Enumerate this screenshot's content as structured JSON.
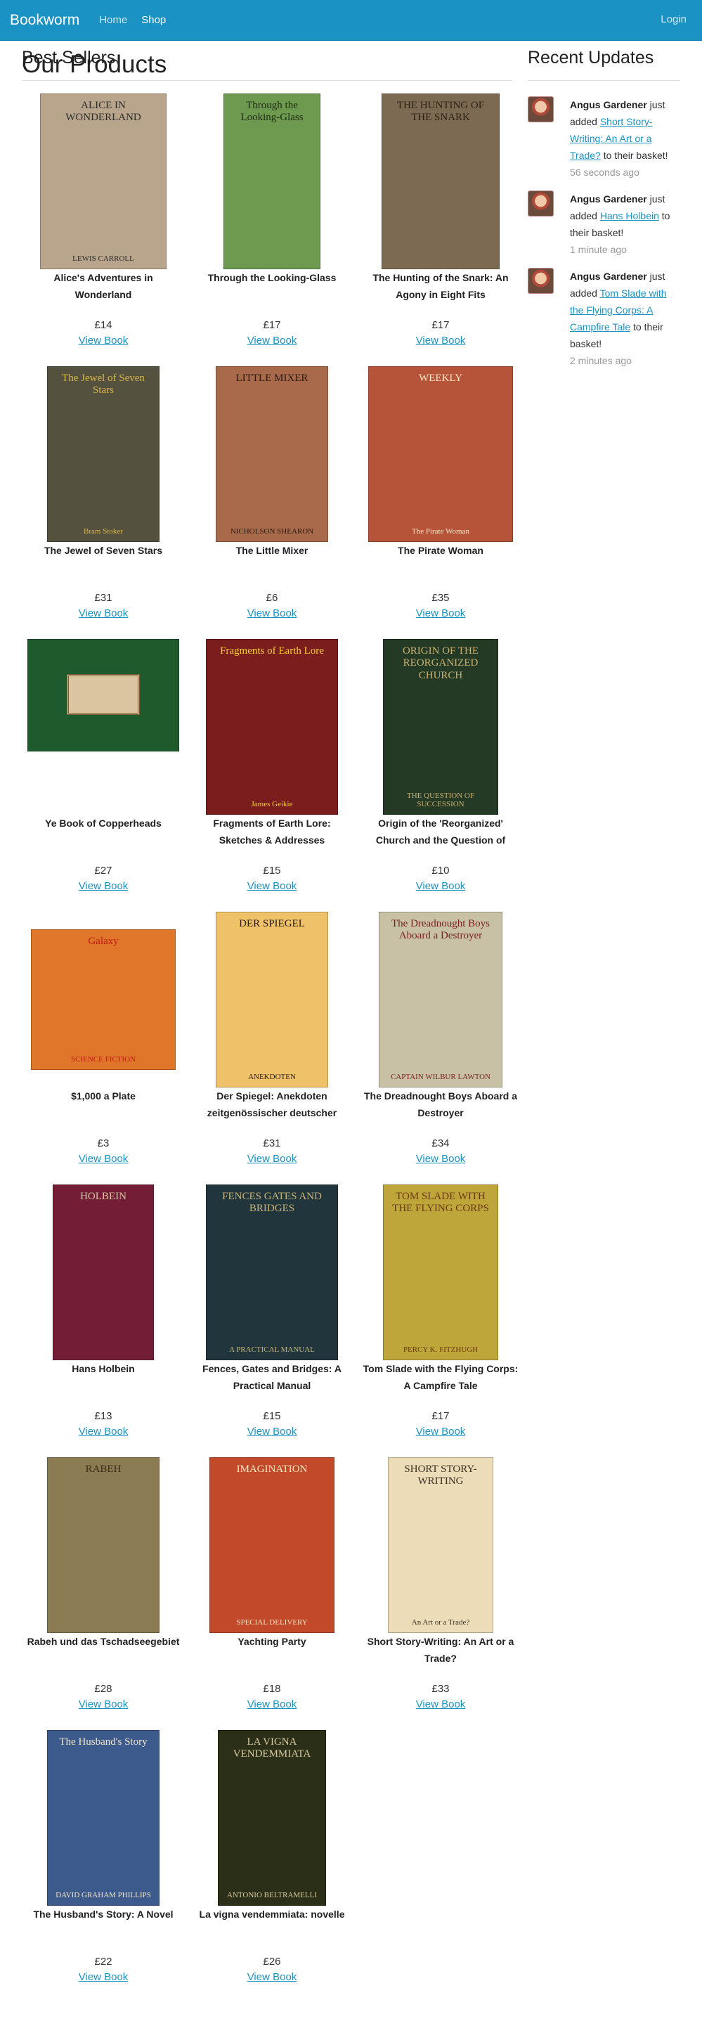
{
  "nav": {
    "brand": "Bookworm",
    "home": "Home",
    "shop": "Shop",
    "login": "Login"
  },
  "page_title": "Our Products",
  "best_sellers_title": "Best Sellers",
  "recent_updates_title": "Recent Updates",
  "view_label": "View Book",
  "books": [
    {
      "title": "Alice's Adventures in Wonderland",
      "price": "£14",
      "cover_title": "ALICE IN WONDERLAND",
      "cover_sub": "LEWIS CARROLL",
      "bg": "#b8a58c",
      "fg": "#2b2b2b"
    },
    {
      "title": "Through the Looking-Glass",
      "price": "£17",
      "cover_title": "Through the Looking-Glass",
      "cover_sub": "",
      "bg": "#6d9a4f",
      "fg": "#1f2a14"
    },
    {
      "title": "The Hunting of the Snark: An Agony in Eight Fits",
      "price": "£17",
      "cover_title": "THE HUNTING OF THE SNARK",
      "cover_sub": "",
      "bg": "#7d6a52",
      "fg": "#2a1f14"
    },
    {
      "title": "The Jewel of Seven Stars",
      "price": "£31",
      "cover_title": "The Jewel of Seven Stars",
      "cover_sub": "Bram Stoker",
      "bg": "#55513f",
      "fg": "#d8b64a"
    },
    {
      "title": "The Little Mixer",
      "price": "£6",
      "cover_title": "LITTLE MIXER",
      "cover_sub": "NICHOLSON SHEARON",
      "bg": "#a86a4a",
      "fg": "#2a1a10"
    },
    {
      "title": "The Pirate Woman",
      "price": "£35",
      "cover_title": "WEEKLY",
      "cover_sub": "The Pirate Woman",
      "bg": "#b6543a",
      "fg": "#fbe8c8"
    },
    {
      "title": "Ye Book of Copperheads",
      "price": "£27",
      "cover_title": "",
      "cover_sub": "",
      "bg": "#1f5a2c",
      "fg": "#e8d6b0"
    },
    {
      "title": "Fragments of Earth Lore: Sketches & Addresses",
      "price": "£15",
      "cover_title": "Fragments of Earth Lore",
      "cover_sub": "James Geikie",
      "bg": "#7b1d1d",
      "fg": "#f2d037"
    },
    {
      "title": "Origin of the 'Reorganized' Church and the Question of",
      "price": "£10",
      "cover_title": "ORIGIN OF THE REORGANIZED CHURCH",
      "cover_sub": "THE QUESTION OF SUCCESSION",
      "bg": "#253a25",
      "fg": "#c9b070"
    },
    {
      "title": "$1,000 a Plate",
      "price": "£3",
      "cover_title": "Galaxy",
      "cover_sub": "SCIENCE FICTION",
      "bg": "#e0762a",
      "fg": "#c01818"
    },
    {
      "title": "Der Spiegel: Anekdoten zeitgenössischer deutscher",
      "price": "£31",
      "cover_title": "DER SPIEGEL",
      "cover_sub": "ANEKDOTEN",
      "bg": "#efc26a",
      "fg": "#2a1a10"
    },
    {
      "title": "The Dreadnought Boys Aboard a Destroyer",
      "price": "£34",
      "cover_title": "The Dreadnought Boys Aboard a Destroyer",
      "cover_sub": "CAPTAIN WILBUR LAWTON",
      "bg": "#c9c1a6",
      "fg": "#7a1f1f"
    },
    {
      "title": "Hans Holbein",
      "price": "£13",
      "cover_title": "HOLBEIN",
      "cover_sub": "",
      "bg": "#741d36",
      "fg": "#d9c4a3"
    },
    {
      "title": "Fences, Gates and Bridges: A Practical Manual",
      "price": "£15",
      "cover_title": "FENCES GATES AND BRIDGES",
      "cover_sub": "A PRACTICAL MANUAL",
      "bg": "#21363c",
      "fg": "#c9b277"
    },
    {
      "title": "Tom Slade with the Flying Corps: A Campfire Tale",
      "price": "£17",
      "cover_title": "TOM SLADE WITH THE FLYING CORPS",
      "cover_sub": "PERCY K. FITZHUGH",
      "bg": "#bfa63a",
      "fg": "#6b3a12"
    },
    {
      "title": "Rabeh und das Tschadseegebiet",
      "price": "£28",
      "cover_title": "RABEH",
      "cover_sub": "",
      "bg": "#8b7b53",
      "fg": "#3b2e18"
    },
    {
      "title": "Yachting Party",
      "price": "£18",
      "cover_title": "IMAGINATION",
      "cover_sub": "SPECIAL DELIVERY",
      "bg": "#c24a2a",
      "fg": "#f4e4c2"
    },
    {
      "title": "Short Story-Writing: An Art or a Trade?",
      "price": "£33",
      "cover_title": "SHORT STORY-WRITING",
      "cover_sub": "An Art or a Trade?",
      "bg": "#ecdcb7",
      "fg": "#3a3024"
    },
    {
      "title": "The Husband's Story: A Novel",
      "price": "£22",
      "cover_title": "The Husband's Story",
      "cover_sub": "DAVID GRAHAM PHILLIPS",
      "bg": "#3d5a8c",
      "fg": "#f2e6c8"
    },
    {
      "title": "La vigna vendemmiata: novelle",
      "price": "£26",
      "cover_title": "LA VIGNA VENDEMMIATA",
      "cover_sub": "ANTONIO BELTRAMELLI",
      "bg": "#2c2f18",
      "fg": "#d8caa0"
    }
  ],
  "updates": [
    {
      "user": "Angus Gardener",
      "pre": " just added ",
      "book": "Short Story-Writing: An Art or a Trade?",
      "post": " to their basket!",
      "time": "56 seconds ago"
    },
    {
      "user": "Angus Gardener",
      "pre": " just added ",
      "book": "Hans Holbein",
      "post": " to their basket!",
      "time": "1 minute ago"
    },
    {
      "user": "Angus Gardener",
      "pre": " just added ",
      "book": "Tom Slade with the Flying Corps: A Campfire Tale",
      "post": " to their basket!",
      "time": "2 minutes ago"
    }
  ]
}
